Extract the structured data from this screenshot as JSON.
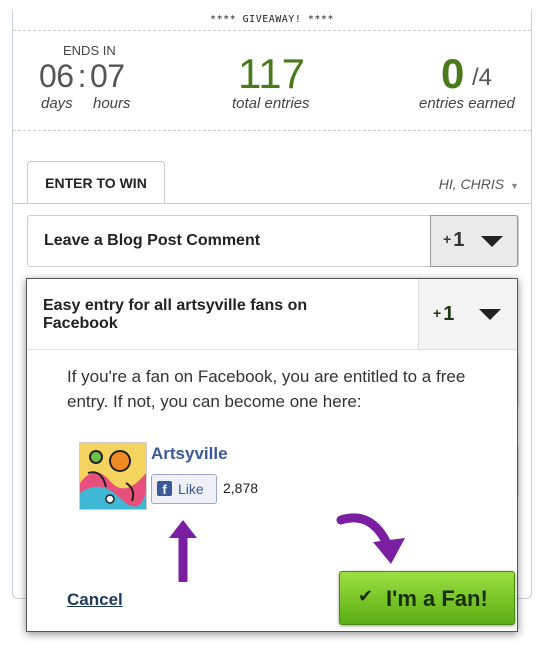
{
  "giveaway": {
    "title": "**** GIVEAWAY! ****"
  },
  "stats": {
    "ends_in_label": "ENDS IN",
    "days_value": "06",
    "hours_value": "07",
    "colon": ":",
    "days_label": "days",
    "hours_label": "hours",
    "total_entries_value": "117",
    "total_entries_label": "total entries",
    "entries_earned_value": "0",
    "entries_earned_total": "/4",
    "entries_earned_label": "entries earned"
  },
  "tabs": {
    "enter_to_win": "ENTER TO WIN",
    "user_greeting": "HI, CHRIS"
  },
  "entries": [
    {
      "title": "Leave a Blog Post Comment",
      "plus": "+",
      "points": "1"
    },
    {
      "title": "Easy entry for all artsyville fans on Facebook",
      "plus": "+",
      "points": "1",
      "description": "If you're a fan on Facebook, you are entitled to a free entry. If not, you can become one here:",
      "facebook": {
        "page_name": "Artsyville",
        "like_icon": "f",
        "like_label": "Like",
        "like_count": "2,878"
      },
      "cancel_label": "Cancel",
      "confirm_label": "I'm a Fan!",
      "confirm_icon": "✔"
    }
  ],
  "colors": {
    "accent_green": "#4a7a1c",
    "fan_button_green": "#6cc11f",
    "facebook_blue": "#3b5998",
    "annotation_purple": "#7b1fa2"
  },
  "icons": {
    "dropdown": "caret-down-icon",
    "check": "check-icon",
    "facebook": "facebook-icon",
    "annotation_arrows": "purple-arrow-icon"
  }
}
